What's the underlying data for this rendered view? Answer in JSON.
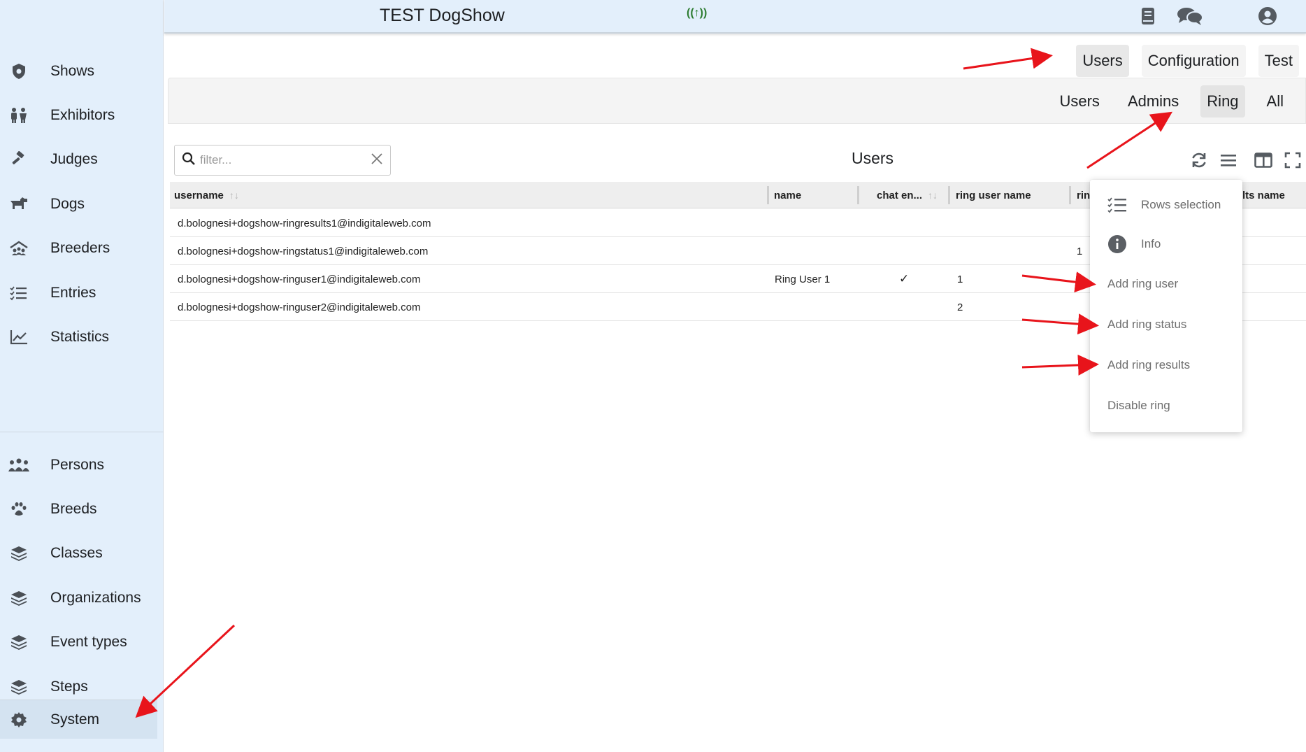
{
  "header": {
    "title": "TEST DogShow",
    "signal_glyph": "((↑))"
  },
  "sidebar": {
    "top_items": [
      {
        "label": "Shows",
        "icon": "shield-dog-icon"
      },
      {
        "label": "Exhibitors",
        "icon": "people-icon"
      },
      {
        "label": "Judges",
        "icon": "gavel-icon"
      },
      {
        "label": "Dogs",
        "icon": "dog-icon"
      },
      {
        "label": "Breeders",
        "icon": "breeders-icon"
      },
      {
        "label": "Entries",
        "icon": "checklist-icon"
      },
      {
        "label": "Statistics",
        "icon": "chart-line-icon"
      }
    ],
    "bottom_items": [
      {
        "label": "Persons",
        "icon": "group-icon"
      },
      {
        "label": "Breeds",
        "icon": "paw-icon"
      },
      {
        "label": "Classes",
        "icon": "layers-icon"
      },
      {
        "label": "Organizations",
        "icon": "layers-icon"
      },
      {
        "label": "Event types",
        "icon": "layers-icon"
      },
      {
        "label": "Steps",
        "icon": "layers-icon"
      }
    ],
    "system_label": "System"
  },
  "main_tabs": [
    "Users",
    "Configuration",
    "Test"
  ],
  "main_tab_active": "Users",
  "sub_tabs": [
    "Users",
    "Admins",
    "Ring",
    "All"
  ],
  "sub_tab_active": "Ring",
  "filter": {
    "placeholder": "filter..."
  },
  "table": {
    "title": "Users",
    "columns": {
      "username": "username",
      "name": "name",
      "chat": "chat en...",
      "ring_user_name": "ring user name",
      "rin": "rin",
      "results_name": "lts name"
    },
    "sort_glyph": "↑↓",
    "rows": [
      {
        "username": "d.bolognesi+dogshow-ringresults1@indigitaleweb.com",
        "name": "",
        "chat": "",
        "ring_user_name": "",
        "rin": ""
      },
      {
        "username": "d.bolognesi+dogshow-ringstatus1@indigitaleweb.com",
        "name": "",
        "chat": "",
        "ring_user_name": "",
        "rin": "1"
      },
      {
        "username": "d.bolognesi+dogshow-ringuser1@indigitaleweb.com",
        "name": "Ring User 1",
        "chat": "✓",
        "ring_user_name": "1",
        "rin": ""
      },
      {
        "username": "d.bolognesi+dogshow-ringuser2@indigitaleweb.com",
        "name": "",
        "chat": "",
        "ring_user_name": "2",
        "rin": ""
      }
    ]
  },
  "menu": {
    "items": [
      {
        "label": "Rows selection",
        "icon": "list-check-icon"
      },
      {
        "label": "Info",
        "icon": "info-icon"
      },
      {
        "label": "Add ring user",
        "icon": ""
      },
      {
        "label": "Add ring status",
        "icon": ""
      },
      {
        "label": "Add ring results",
        "icon": ""
      },
      {
        "label": "Disable ring",
        "icon": ""
      }
    ]
  },
  "colors": {
    "sidebar_bg": "#e3effb",
    "annotation_arrow": "#e8141b",
    "signal": "#2e7d32"
  }
}
